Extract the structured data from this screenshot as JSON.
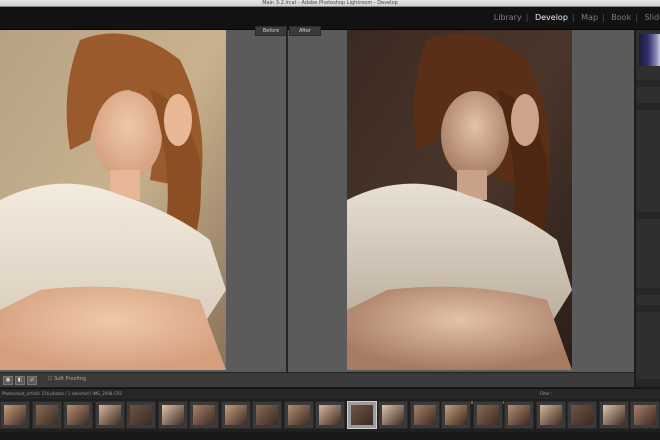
{
  "window": {
    "title": "Main 3-2.lrcat - Adobe Photoshop Lightroom - Develop"
  },
  "modules": {
    "items": [
      "Library",
      "Develop",
      "Map",
      "Book",
      "Slide"
    ],
    "active": "Develop"
  },
  "view": {
    "before_label": "Before",
    "after_label": "After"
  },
  "toolbar": {
    "soft_proofing_label": "Soft Proofing"
  },
  "filmstrip": {
    "path_text": "Photoshoot_artistic   156 photos / 1 selected / IMG_2098.CR2",
    "filter_label": "Filter :",
    "thumbnail_count": 21,
    "selected_index": 11
  },
  "colors": {
    "background": "#5b5b5b",
    "active_module": "#ececec",
    "inactive_module": "#7d7d7d"
  }
}
